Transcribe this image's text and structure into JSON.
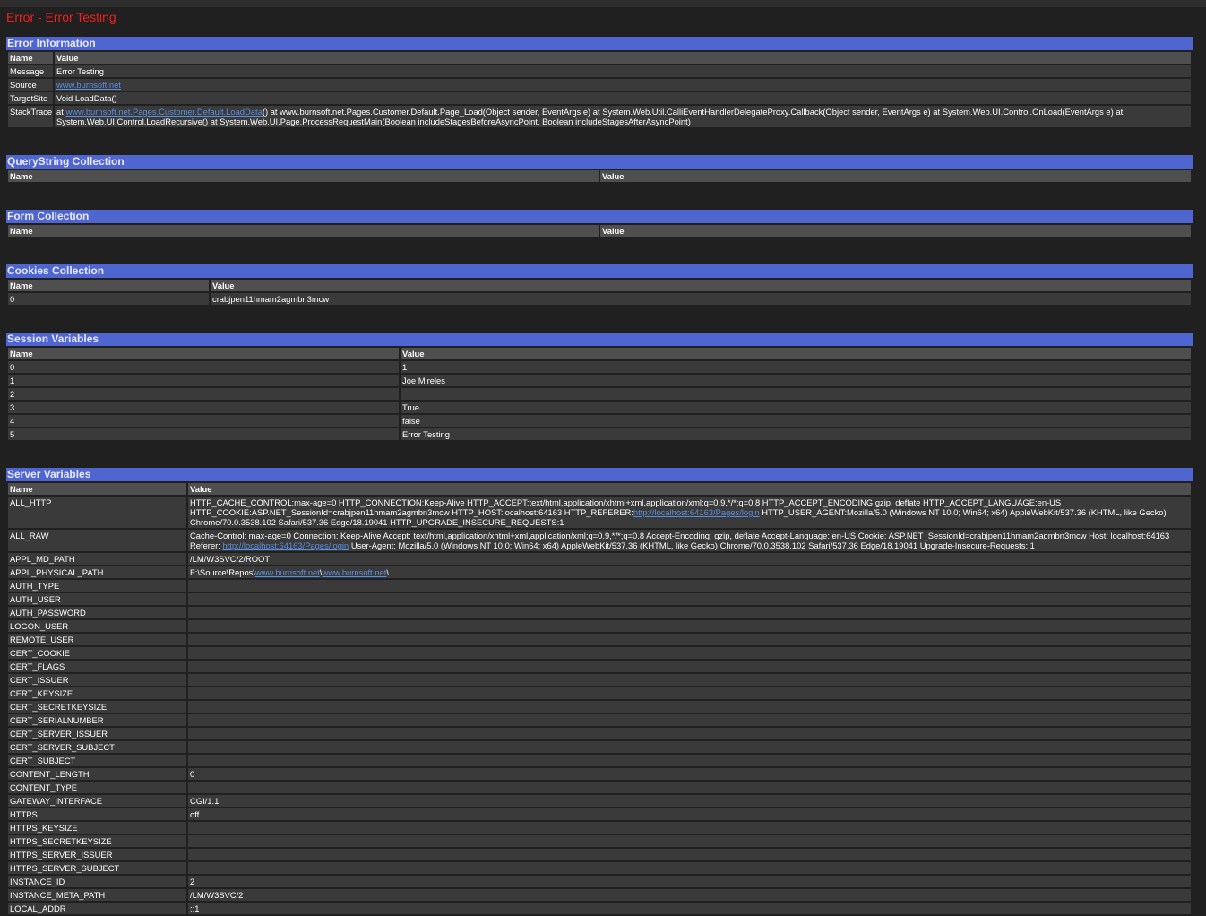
{
  "page_title": "Error - Error Testing",
  "colors": {
    "background": "#202020",
    "header_band": "#4f66d0",
    "title": "#ee2020",
    "row": "#3a3a3a",
    "header_row": "#4f4f4f",
    "link": "#5a8fe0"
  },
  "error_info": {
    "header": "Error Information",
    "col_name": "Name",
    "col_value": "Value",
    "message_label": "Message",
    "message_value": "Error Testing",
    "source_label": "Source",
    "source_link": "www.burnsoft.net",
    "targetsite_label": "TargetSite",
    "targetsite_value": "Void LoadData()",
    "stacktrace_label": "StackTrace",
    "stack_prefix": "at ",
    "stack_link": "www.burnsoft.net.Pages.Customer.Default.LoadData",
    "stack_rest": "() at www.burnsoft.net.Pages.Customer.Default.Page_Load(Object sender, EventArgs e) at System.Web.Util.CalliEventHandlerDelegateProxy.Callback(Object sender, EventArgs e) at System.Web.UI.Control.OnLoad(EventArgs e) at System.Web.UI.Control.LoadRecursive() at System.Web.UI.Page.ProcessRequestMain(Boolean includeStagesBeforeAsyncPoint, Boolean includeStagesAfterAsyncPoint)"
  },
  "querystring": {
    "header": "QueryString Collection",
    "col_name": "Name",
    "col_value": "Value"
  },
  "form": {
    "header": "Form Collection",
    "col_name": "Name",
    "col_value": "Value"
  },
  "cookies": {
    "header": "Cookies Collection",
    "col_name": "Name",
    "col_value": "Value",
    "rows": [
      {
        "name": "0",
        "value": "crabjpen11hmam2agmbn3mcw"
      }
    ]
  },
  "session": {
    "header": "Session Variables",
    "col_name": "Name",
    "col_value": "Value",
    "rows": [
      {
        "name": "0",
        "value": "1"
      },
      {
        "name": "1",
        "value": "Joe Mireles"
      },
      {
        "name": "2",
        "value": ""
      },
      {
        "name": "3",
        "value": "True"
      },
      {
        "name": "4",
        "value": "false"
      },
      {
        "name": "5",
        "value": "Error Testing"
      }
    ]
  },
  "server": {
    "header": "Server Variables",
    "col_name": "Name",
    "col_value": "Value",
    "all_http_name": "ALL_HTTP",
    "all_http_a": "HTTP_CACHE_CONTROL:max-age=0 HTTP_CONNECTION:Keep-Alive HTTP_ACCEPT:text/html,application/xhtml+xml,application/xml;q=0.9,*/*;q=0.8 HTTP_ACCEPT_ENCODING:gzip, deflate HTTP_ACCEPT_LANGUAGE:en-US HTTP_COOKIE:ASP.NET_SessionId=crabjpen11hmam2agmbn3mcw HTTP_HOST:localhost:64163 HTTP_REFERER:",
    "all_http_link": "http://localhost:64163/Pages/login",
    "all_http_b": " HTTP_USER_AGENT:Mozilla/5.0 (Windows NT 10.0; Win64; x64) AppleWebKit/537.36 (KHTML, like Gecko) Chrome/70.0.3538.102 Safari/537.36 Edge/18.19041 HTTP_UPGRADE_INSECURE_REQUESTS:1",
    "all_raw_name": "ALL_RAW",
    "all_raw_a": "Cache-Control: max-age=0 Connection: Keep-Alive Accept: text/html,application/xhtml+xml,application/xml;q=0.9,*/*;q=0.8 Accept-Encoding: gzip, deflate Accept-Language: en-US Cookie: ASP.NET_SessionId=crabjpen11hmam2agmbn3mcw Host: localhost:64163 Referer: ",
    "all_raw_link": "http://localhost:64163/Pages/login",
    "all_raw_b": " User-Agent: Mozilla/5.0 (Windows NT 10.0; Win64; x64) AppleWebKit/537.36 (KHTML, like Gecko) Chrome/70.0.3538.102 Safari/537.36 Edge/18.19041 Upgrade-Insecure-Requests: 1",
    "phys_name": "APPL_PHYSICAL_PATH",
    "phys_a": "F:\\Source\\Repos\\",
    "phys_link1": "www.burnsoft.net",
    "phys_sep": "\\",
    "phys_link2": "www.burnsoft.net",
    "phys_end": "\\",
    "rows_before": [
      {
        "name": "APPL_MD_PATH",
        "value": "/LM/W3SVC/2/ROOT"
      }
    ],
    "rows": [
      {
        "name": "AUTH_TYPE",
        "value": ""
      },
      {
        "name": "AUTH_USER",
        "value": ""
      },
      {
        "name": "AUTH_PASSWORD",
        "value": ""
      },
      {
        "name": "LOGON_USER",
        "value": ""
      },
      {
        "name": "REMOTE_USER",
        "value": ""
      },
      {
        "name": "CERT_COOKIE",
        "value": ""
      },
      {
        "name": "CERT_FLAGS",
        "value": ""
      },
      {
        "name": "CERT_ISSUER",
        "value": ""
      },
      {
        "name": "CERT_KEYSIZE",
        "value": ""
      },
      {
        "name": "CERT_SECRETKEYSIZE",
        "value": ""
      },
      {
        "name": "CERT_SERIALNUMBER",
        "value": ""
      },
      {
        "name": "CERT_SERVER_ISSUER",
        "value": ""
      },
      {
        "name": "CERT_SERVER_SUBJECT",
        "value": ""
      },
      {
        "name": "CERT_SUBJECT",
        "value": ""
      },
      {
        "name": "CONTENT_LENGTH",
        "value": "0"
      },
      {
        "name": "CONTENT_TYPE",
        "value": ""
      },
      {
        "name": "GATEWAY_INTERFACE",
        "value": "CGI/1.1"
      },
      {
        "name": "HTTPS",
        "value": "off"
      },
      {
        "name": "HTTPS_KEYSIZE",
        "value": ""
      },
      {
        "name": "HTTPS_SECRETKEYSIZE",
        "value": ""
      },
      {
        "name": "HTTPS_SERVER_ISSUER",
        "value": ""
      },
      {
        "name": "HTTPS_SERVER_SUBJECT",
        "value": ""
      },
      {
        "name": "INSTANCE_ID",
        "value": "2"
      },
      {
        "name": "INSTANCE_META_PATH",
        "value": "/LM/W3SVC/2"
      },
      {
        "name": "LOCAL_ADDR",
        "value": "::1"
      }
    ]
  }
}
